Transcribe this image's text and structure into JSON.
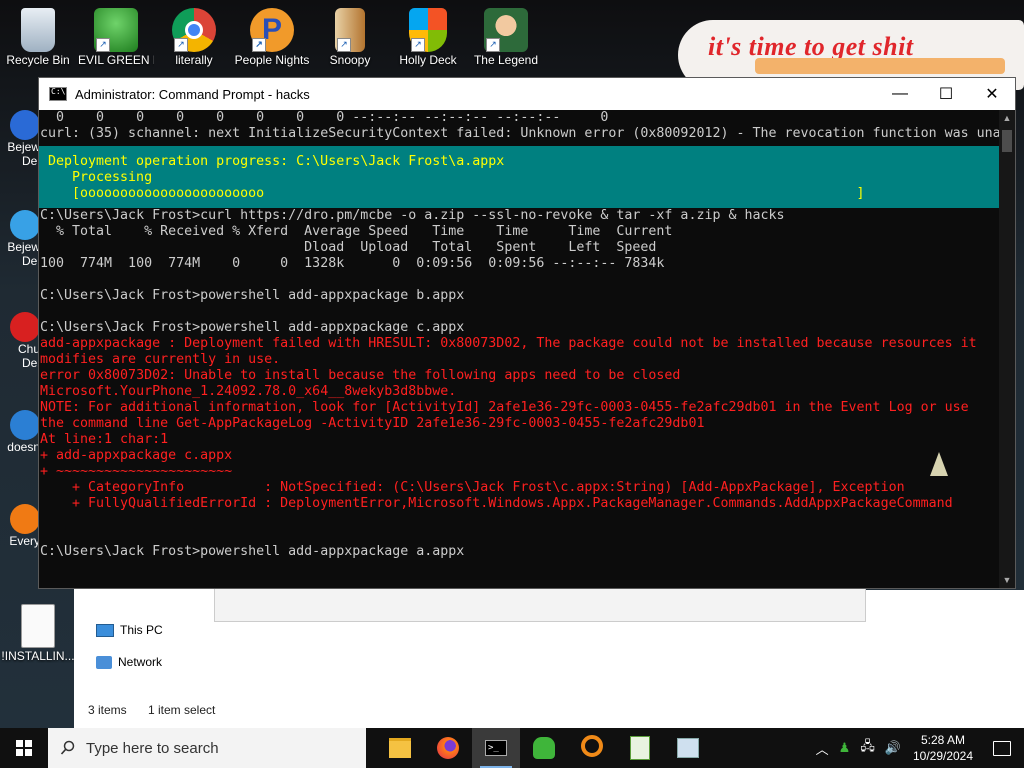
{
  "desktop": {
    "banner_text": "it's time to get shit",
    "top_icons": [
      {
        "label": "Recycle Bin",
        "icon": "recycle-bin-icon"
      },
      {
        "label": "EVIL GREEN MEN GO",
        "icon": "green-men-icon"
      },
      {
        "label": "literally",
        "icon": "chrome-icon"
      },
      {
        "label": "People Nights",
        "icon": "p-app-icon"
      },
      {
        "label": "Snoopy",
        "icon": "book-icon"
      },
      {
        "label": "Holly Deck",
        "icon": "windows-shield-icon"
      },
      {
        "label": "The Legend",
        "icon": "character-icon"
      }
    ],
    "side_icons": [
      {
        "label": "Bejew Del",
        "icon": "bejeweled-icon"
      },
      {
        "label": "Bejew Del",
        "icon": "bejeweled-blue-icon"
      },
      {
        "label": "Chu Del",
        "icon": "red-orb-icon"
      },
      {
        "label": "doesn",
        "icon": "blue-orb-icon"
      },
      {
        "label": "Every",
        "icon": "orange-orb-icon"
      }
    ],
    "file_icon_label": "!INSTALLIN..."
  },
  "explorer": {
    "nav_this_pc": "This PC",
    "nav_network": "Network",
    "status_items": "3 items",
    "status_selected": "1 item select"
  },
  "cmd": {
    "title": "Administrator: Command Prompt - hacks",
    "minimize": "—",
    "maximize": "☐",
    "close": "✕",
    "lines_top": [
      "  0    0    0    0    0    0    0    0 --:--:-- --:--:-- --:--:--     0",
      "curl: (35) schannel: next InitializeSecurityContext failed: Unknown error (0x80092012) - The revocation function was una"
    ],
    "progress_lines": [
      "Deployment operation progress: C:\\Users\\Jack Frost\\a.appx",
      "   Processing",
      "   [ooooooooooooooooooooooo                                                                          ]"
    ],
    "lines_mid": [
      "C:\\Users\\Jack Frost>curl https://dro.pm/mcbe -o a.zip --ssl-no-revoke & tar -xf a.zip & hacks",
      "  % Total    % Received % Xferd  Average Speed   Time    Time     Time  Current",
      "                                 Dload  Upload   Total   Spent    Left  Speed",
      "100  774M  100  774M    0     0  1328k      0  0:09:56  0:09:56 --:--:-- 7834k",
      "",
      "C:\\Users\\Jack Frost>powershell add-appxpackage b.appx",
      "",
      "C:\\Users\\Jack Frost>powershell add-appxpackage c.appx"
    ],
    "error_lines": [
      "add-appxpackage : Deployment failed with HRESULT: 0x80073D02, The package could not be installed because resources it",
      "modifies are currently in use.",
      "error 0x80073D02: Unable to install because the following apps need to be closed",
      "Microsoft.YourPhone_1.24092.78.0_x64__8wekyb3d8bbwe.",
      "NOTE: For additional information, look for [ActivityId] 2afe1e36-29fc-0003-0455-fe2afc29db01 in the Event Log or use",
      "the command line Get-AppPackageLog -ActivityID 2afe1e36-29fc-0003-0455-fe2afc29db01",
      "At line:1 char:1",
      "+ add-appxpackage c.appx",
      "+ ~~~~~~~~~~~~~~~~~~~~~~",
      "    + CategoryInfo          : NotSpecified: (C:\\Users\\Jack Frost\\c.appx:String) [Add-AppxPackage], Exception",
      "    + FullyQualifiedErrorId : DeploymentError,Microsoft.Windows.Appx.PackageManager.Commands.AddAppxPackageCommand"
    ],
    "lines_end": [
      "",
      "",
      "C:\\Users\\Jack Frost>powershell add-appxpackage a.appx"
    ]
  },
  "taskbar": {
    "search_placeholder": "Type here to search",
    "apps": [
      "file-explorer-icon",
      "firefox-icon",
      "command-prompt-icon",
      "green-men-icon",
      "search-app-icon",
      "notepad-chart-icon",
      "window-app-icon"
    ],
    "time": "5:28 AM",
    "date": "10/29/2024"
  },
  "colors": {
    "terminal_bg": "#0c0c0c",
    "terminal_fg": "#cccccc",
    "progress_bg": "#008080",
    "progress_fg": "#ffff00",
    "error_fg": "#ff2020",
    "banner_red": "#e0262b"
  }
}
